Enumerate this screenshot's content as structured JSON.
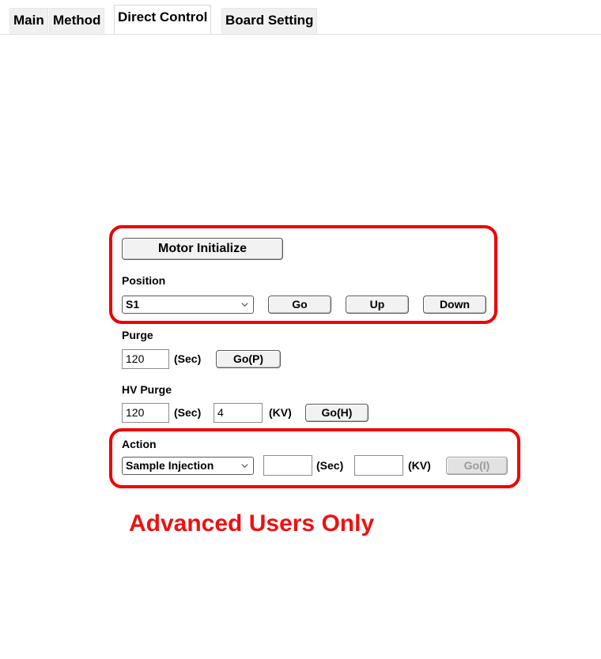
{
  "tabs": [
    {
      "label": "Main",
      "active": false
    },
    {
      "label": "Method",
      "active": false
    },
    {
      "label": "Direct Control",
      "active": true
    },
    {
      "label": "Board Setting",
      "active": false
    }
  ],
  "motor": {
    "initialize_label": "Motor Initialize"
  },
  "position": {
    "label": "Position",
    "selected": "S1",
    "go_label": "Go",
    "up_label": "Up",
    "down_label": "Down"
  },
  "purge": {
    "label": "Purge",
    "seconds_value": "120",
    "sec_unit": "(Sec)",
    "go_label": "Go(P)"
  },
  "hv_purge": {
    "label": "HV Purge",
    "seconds_value": "120",
    "sec_unit": "(Sec)",
    "kv_value": "4",
    "kv_unit": "(KV)",
    "go_label": "Go(H)"
  },
  "action": {
    "label": "Action",
    "selected": "Sample Injection",
    "seconds_value": "",
    "sec_unit": "(Sec)",
    "kv_value": "",
    "kv_unit": "(KV)",
    "go_label": "Go(I)"
  },
  "annotation": {
    "text": "Advanced Users Only",
    "color": "#ee1111"
  }
}
